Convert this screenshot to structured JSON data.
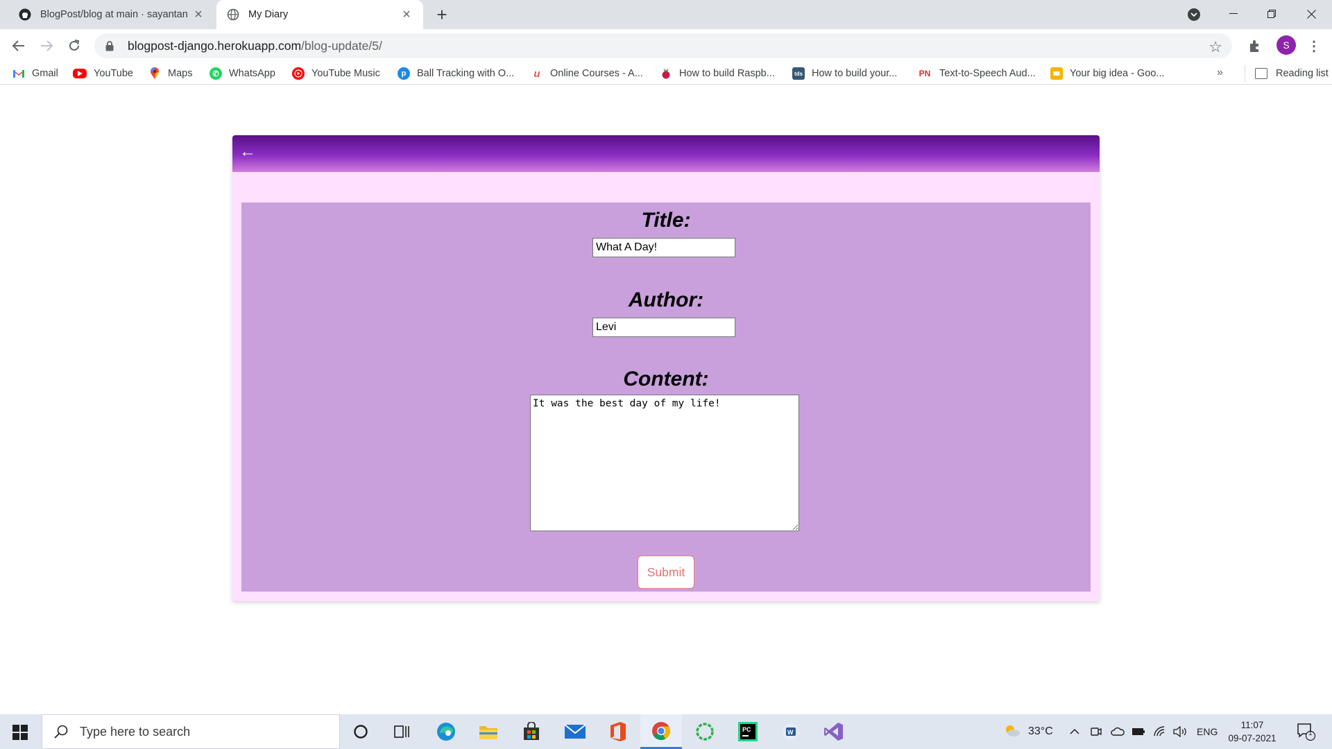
{
  "browser": {
    "tabs": [
      {
        "title": "BlogPost/blog at main · sayantan",
        "favicon": "github-icon",
        "active": false
      },
      {
        "title": "My Diary",
        "favicon": "globe-icon",
        "active": true
      }
    ],
    "url_host": "blogpost-django.herokuapp.com",
    "url_path": "/blog-update/5/",
    "profile_initial": "S",
    "profile_color": "#8e24aa",
    "bookmarks": [
      {
        "label": "Gmail",
        "icon": "gmail-icon"
      },
      {
        "label": "YouTube",
        "icon": "youtube-icon"
      },
      {
        "label": "Maps",
        "icon": "maps-icon"
      },
      {
        "label": "WhatsApp",
        "icon": "whatsapp-icon"
      },
      {
        "label": "YouTube Music",
        "icon": "youtube-music-icon"
      },
      {
        "label": "Ball Tracking with O...",
        "icon": "p-icon"
      },
      {
        "label": "Online Courses - A...",
        "icon": "udemy-icon"
      },
      {
        "label": "How to build Raspb...",
        "icon": "raspberry-icon"
      },
      {
        "label": "How to build your...",
        "icon": "tds-icon"
      },
      {
        "label": "Text-to-Speech Aud...",
        "icon": "pn-icon"
      },
      {
        "label": "Your big idea - Goo...",
        "icon": "slides-icon"
      }
    ],
    "bookmarks_more": "»",
    "reading_list": "Reading list"
  },
  "page": {
    "back_arrow": "←",
    "title_label": "Title:",
    "title_value": "What A Day!",
    "author_label": "Author:",
    "author_value": "Levi",
    "content_label": "Content:",
    "content_value": "It was the best day of my life!",
    "submit_label": "Submit",
    "colors": {
      "header_top": "#5a0f8a",
      "header_bottom": "#d27ce0",
      "card_bg": "#ffe0ff",
      "form_bg": "#c9a0dc",
      "submit_text": "#e87070"
    }
  },
  "taskbar": {
    "search_placeholder": "Type here to search",
    "apps": [
      "cortana-icon",
      "task-view-icon",
      "edge-icon",
      "file-explorer-icon",
      "store-icon",
      "mail-icon",
      "office-icon",
      "chrome-icon",
      "loading-app-icon",
      "pycharm-icon",
      "word-icon",
      "visual-studio-icon"
    ],
    "weather_temp": "33°C",
    "language": "ENG",
    "time": "11:07",
    "date": "09-07-2021",
    "notification_count": "1"
  }
}
